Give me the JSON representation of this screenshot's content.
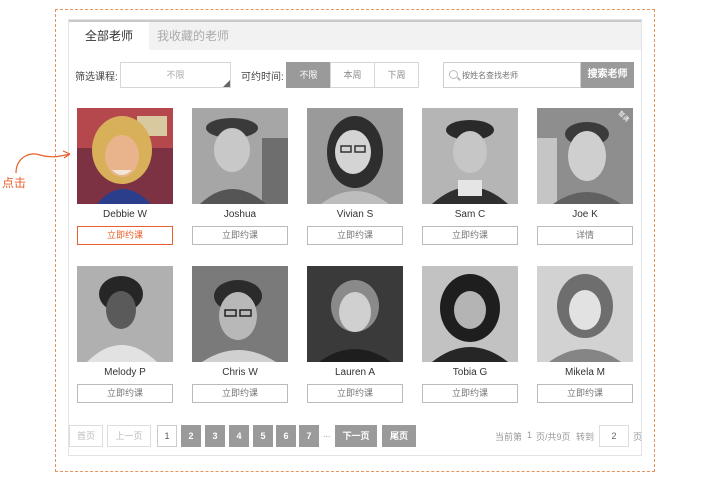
{
  "tabs": {
    "active": "全部老师",
    "inactive": "我收藏的老师"
  },
  "filter": {
    "course_label": "筛选课程:",
    "course_value": "不限",
    "time_label": "可约时间:",
    "time_options": [
      "不限",
      "本周",
      "下周"
    ],
    "time_selected": "不限",
    "search_placeholder": "按姓名查找老师",
    "search_button": "搜索老师"
  },
  "teachers": [
    {
      "name": "Debbie W",
      "action": "立即约课",
      "highlight": true
    },
    {
      "name": "Joshua",
      "action": "立即约课"
    },
    {
      "name": "Vivian S",
      "action": "立即约课"
    },
    {
      "name": "Sam C",
      "action": "立即约课"
    },
    {
      "name": "Joe K",
      "action": "详情",
      "badge": "暂满"
    },
    {
      "name": "Melody P",
      "action": "立即约课"
    },
    {
      "name": "Chris W",
      "action": "立即约课"
    },
    {
      "name": "Lauren A",
      "action": "立即约课"
    },
    {
      "name": "Tobia G",
      "action": "立即约课"
    },
    {
      "name": "Mikela M",
      "action": "立即约课"
    }
  ],
  "pager": {
    "first": "首页",
    "prev": "上一页",
    "pages": [
      "1",
      "2",
      "3",
      "4",
      "5",
      "6",
      "7"
    ],
    "current": "1",
    "ellipsis": "...",
    "next": "下一页",
    "last": "尾页",
    "info_prefix": "当前第",
    "info_current": "1",
    "info_mid": "页/共9页",
    "goto_label": "转到",
    "goto_value": "2",
    "goto_suffix": "页"
  },
  "annotation": {
    "text": "点击"
  },
  "colors": {
    "accent": "#e8602c",
    "gray": "#9a9a9a",
    "frame": "#e8925a"
  }
}
